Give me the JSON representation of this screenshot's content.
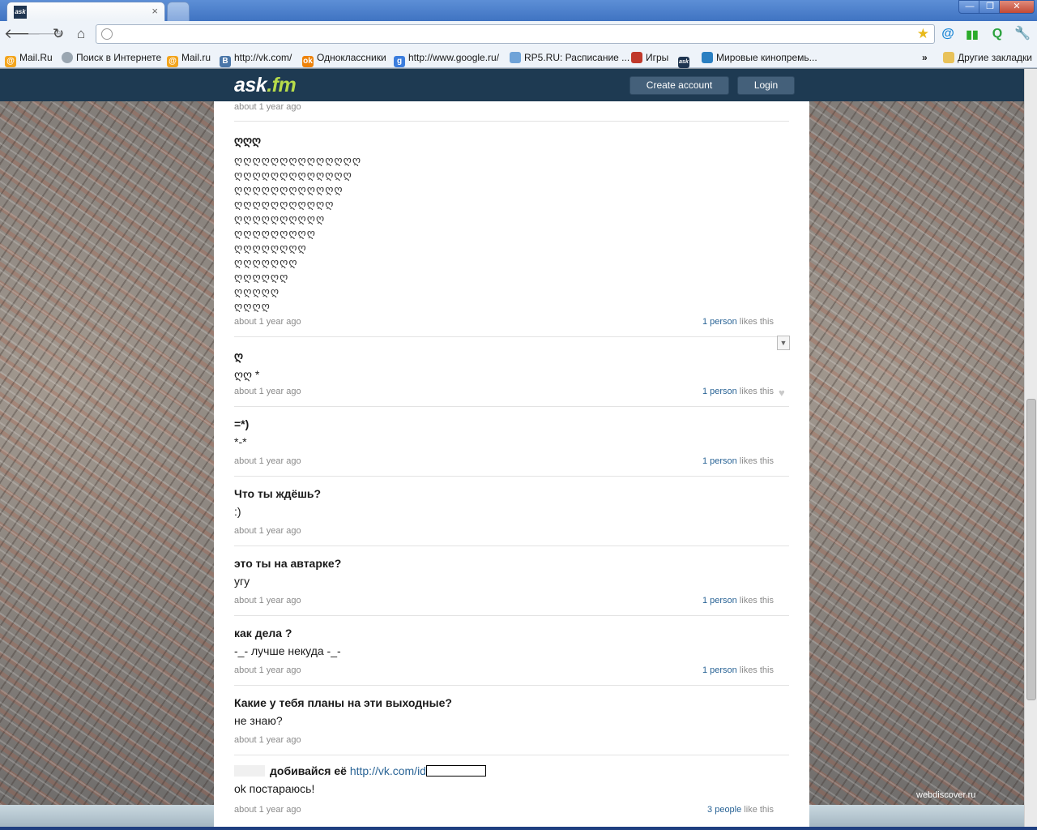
{
  "browser": {
    "tab_favicon": "ask",
    "new_tab_icon": "new-tab-icon",
    "window_buttons": [
      "—",
      "❐",
      "✕"
    ],
    "address_value": "",
    "bookmarks": [
      {
        "label": "Mail.Ru",
        "icon": "mailru-icon"
      },
      {
        "label": "Поиск в Интернете",
        "icon": "globe-icon"
      },
      {
        "label": "Mail.ru",
        "icon": "mailru-icon"
      },
      {
        "label": "http://vk.com/",
        "icon": "vk-icon"
      },
      {
        "label": "Одноклассники",
        "icon": "odnoklassniki-icon"
      },
      {
        "label": "http://www.google.ru/",
        "icon": "google-icon"
      },
      {
        "label": "RP5.RU: Расписание ...",
        "icon": "rp5-icon"
      },
      {
        "label": "Игры",
        "icon": "games-icon"
      },
      {
        "label": "",
        "icon": "askfm-icon"
      },
      {
        "label": "Мировые кинопремь...",
        "icon": "dolphin-icon"
      }
    ],
    "more_bookmarks": "»",
    "other_bookmarks": "Другие закладки"
  },
  "site": {
    "logo_main": "ask",
    "logo_suffix": ".fm",
    "create_account": "Create account",
    "login": "Login",
    "watermark": "webdiscover.ru"
  },
  "feed": {
    "top_time": "about 1 year ago",
    "entries": [
      {
        "question": "ღღღ",
        "answer_lines": [
          "ღღღღღღღღღღღღღღ",
          "ღღღღღღღღღღღღღ",
          "ღღღღღღღღღღღღ",
          "ღღღღღღღღღღღ",
          "ღღღღღღღღღღ",
          "ღღღღღღღღღ",
          "ღღღღღღღღ",
          "ღღღღღღღ",
          "ღღღღღღ",
          "ღღღღღ",
          "ღღღღ"
        ],
        "time": "about 1 year ago",
        "likes_link": "1 person",
        "likes_text": " likes this"
      },
      {
        "question": "ღ",
        "answer": "ღღ *",
        "time": "about 1 year ago",
        "likes_link": "1 person",
        "likes_text": " likes this"
      },
      {
        "question": "=*)",
        "answer": "*-*",
        "time": "about 1 year ago",
        "likes_link": "1 person",
        "likes_text": " likes this"
      },
      {
        "question": "Что ты ждёшь?",
        "answer": ":)",
        "time": "about 1 year ago",
        "likes_link": "",
        "likes_text": ""
      },
      {
        "question": "это ты на автарке?",
        "answer": "угу",
        "time": "about 1 year ago",
        "likes_link": "1 person",
        "likes_text": " likes this"
      },
      {
        "question": "как дела ?",
        "answer": "-_- лучше некуда -_-",
        "time": "about 1 year ago",
        "likes_link": "1 person",
        "likes_text": " likes this"
      },
      {
        "question": "Какие у тебя планы на эти выходные?",
        "answer": "не знаю?",
        "time": "about 1 year ago",
        "likes_link": "",
        "likes_text": ""
      },
      {
        "question": "добивайся её",
        "question_link": "http://vk.com/id",
        "answer": "ok постараюсь!",
        "time": "about 1 year ago",
        "likes_link": "3 people",
        "likes_text": " like this"
      }
    ]
  }
}
